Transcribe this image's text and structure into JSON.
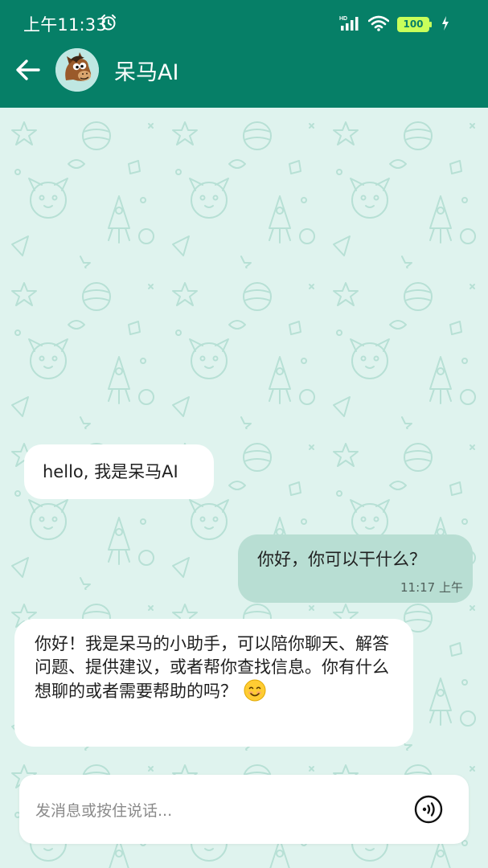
{
  "status_bar": {
    "time": "上午11:33",
    "alarm_icon": "alarm-clock-icon",
    "network_label": "HD",
    "signal_icon": "cell-signal-icon",
    "wifi_icon": "wifi-icon",
    "battery_level": "100",
    "charging_icon": "lightning-bolt-icon"
  },
  "app_bar": {
    "back_icon": "arrow-left-icon",
    "avatar_icon": "cartoon-horse-avatar",
    "title": "呆马AI",
    "background_color": "#067f67"
  },
  "chat": {
    "wallpaper": "doodle-pattern",
    "messages": [
      {
        "role": "bot",
        "text": "hello, 我是呆马AI"
      },
      {
        "role": "user",
        "text": "你好，你可以干什么？",
        "time": "11:17 上午"
      },
      {
        "role": "bot",
        "text": "你好！我是呆马的小助手，可以陪你聊天、解答问题、提供建议，或者帮你查找信息。你有什么想聊的或者需要帮助的吗？",
        "emoji_icon": "smiling-face-emoji"
      }
    ],
    "bot_bubble_color": "#ffffff",
    "user_bubble_color": "#b8ded3",
    "background_color": "#dff3ee"
  },
  "input_bar": {
    "placeholder": "发消息或按住说话...",
    "voice_icon": "voice-wave-icon"
  }
}
